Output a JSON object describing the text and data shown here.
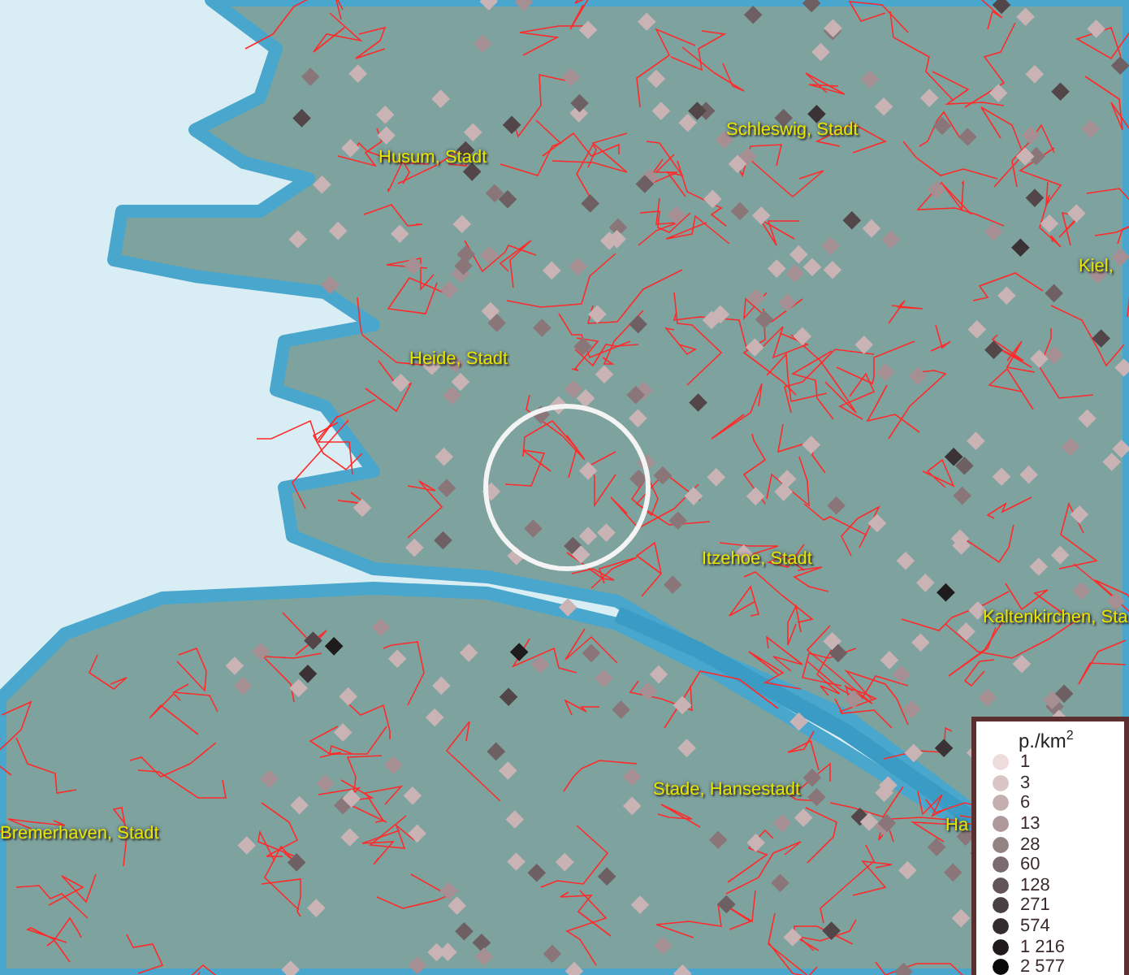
{
  "map": {
    "places": [
      {
        "name": "Schleswig, Stadt"
      },
      {
        "name": "Husum, Stadt"
      },
      {
        "name": "Kiel,"
      },
      {
        "name": "Heide, Stadt"
      },
      {
        "name": "Itzehoe, Stadt"
      },
      {
        "name": "Kaltenkirchen, Sta"
      },
      {
        "name": "Stade, Hansestadt"
      },
      {
        "name": "Ha"
      },
      {
        "name": "Bremerhaven, Stadt"
      }
    ]
  },
  "legend": {
    "title": "p./km$^{2}$",
    "items": [
      {
        "value": "1",
        "color": "#eedcdc"
      },
      {
        "value": "3",
        "color": "#d9c4c6"
      },
      {
        "value": "6",
        "color": "#c4aeb0"
      },
      {
        "value": "13",
        "color": "#ae989b"
      },
      {
        "value": "28",
        "color": "#958285"
      },
      {
        "value": "60",
        "color": "#7c6b6e"
      },
      {
        "value": "128",
        "color": "#625558"
      },
      {
        "value": "271",
        "color": "#4a4043"
      },
      {
        "value": "574",
        "color": "#332c2e"
      },
      {
        "value": "1 216",
        "color": "#1f1a1b"
      },
      {
        "value": "2 577",
        "color": "#0a0808"
      }
    ]
  }
}
